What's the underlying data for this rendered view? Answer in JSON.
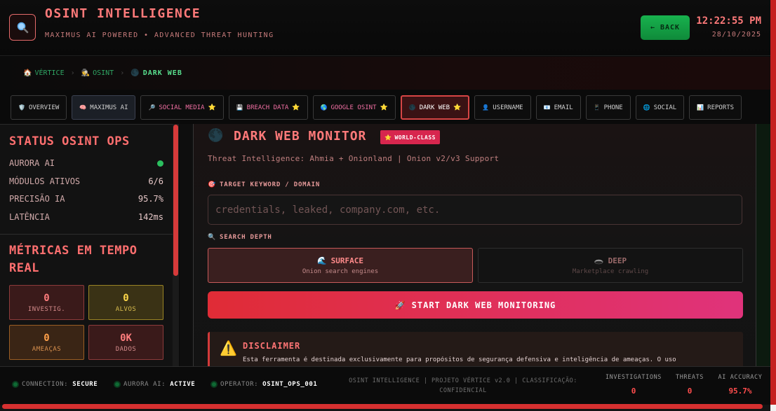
{
  "header": {
    "logo_icon": "magnifier-icon",
    "title": "OSINT INTELLIGENCE",
    "subtitle": "MAXIMUS AI POWERED • ADVANCED THREAT HUNTING",
    "back_label": "← BACK",
    "time": "12:22:55 PM",
    "date": "28/10/2025"
  },
  "breadcrumb": [
    {
      "icon": "🏠",
      "label": "VÉRTICE"
    },
    {
      "icon": "🕵️",
      "label": "OSINT"
    },
    {
      "icon": "🌑",
      "label": "DARK WEB"
    }
  ],
  "tabs": [
    {
      "icon": "🛡️",
      "label": "OVERVIEW",
      "star": ""
    },
    {
      "icon": "🧠",
      "label": "MAXIMUS AI",
      "star": ""
    },
    {
      "icon": "🔎",
      "label": "SOCIAL MEDIA",
      "star": "⭐"
    },
    {
      "icon": "💾",
      "label": "BREACH DATA",
      "star": "⭐"
    },
    {
      "icon": "🌎",
      "label": "GOOGLE OSINT",
      "star": "⭐"
    },
    {
      "icon": "🌑",
      "label": "DARK WEB",
      "star": "⭐"
    },
    {
      "icon": "👤",
      "label": "USERNAME",
      "star": ""
    },
    {
      "icon": "📧",
      "label": "EMAIL",
      "star": ""
    },
    {
      "icon": "📱",
      "label": "PHONE",
      "star": ""
    },
    {
      "icon": "🌐",
      "label": "SOCIAL",
      "star": ""
    },
    {
      "icon": "📊",
      "label": "REPORTS",
      "star": ""
    }
  ],
  "sidebar": {
    "status_title": "STATUS OSINT OPS",
    "status_rows": [
      {
        "label": "AURORA AI",
        "value": ""
      },
      {
        "label": "MÓDULOS ATIVOS",
        "value": "6/6"
      },
      {
        "label": "PRECISÃO IA",
        "value": "95.7%"
      },
      {
        "label": "LATÊNCIA",
        "value": "142ms"
      }
    ],
    "metrics_title": "MÉTRICAS EM TEMPO REAL",
    "metrics": [
      {
        "value": "0",
        "label": "INVESTIG."
      },
      {
        "value": "0",
        "label": "ALVOS"
      },
      {
        "value": "0",
        "label": "AMEAÇAS"
      },
      {
        "value": "0K",
        "label": "DADOS"
      }
    ]
  },
  "main": {
    "icon": "🌑",
    "title": "DARK WEB MONITOR",
    "badge": "WORLD-CLASS",
    "badge_icon": "⭐",
    "description": "Threat Intelligence: Ahmia + Onionland | Onion v2/v3 Support",
    "keyword_label": "TARGET KEYWORD / DOMAIN",
    "keyword_label_icon": "🎯",
    "keyword_placeholder": "credentials, leaked, company.com, etc.",
    "keyword_value": "",
    "depth_label": "SEARCH DEPTH",
    "depth_label_icon": "🔍",
    "depth_options": [
      {
        "icon": "🌊",
        "title": "SURFACE",
        "desc": "Onion search engines",
        "selected": true
      },
      {
        "icon": "🕳️",
        "title": "DEEP",
        "desc": "Marketplace crawling",
        "selected": false
      }
    ],
    "start_icon": "🚀",
    "start_label": "START DARK WEB MONITORING",
    "disclaimer_icon": "⚠️",
    "disclaimer_title": "DISCLAIMER",
    "disclaimer_text": "Esta ferramenta é destinada exclusivamente para propósitos de segurança defensiva e inteligência de ameaças. O uso"
  },
  "footer": {
    "statuses": [
      {
        "label": "CONNECTION:",
        "value": "SECURE"
      },
      {
        "label": "AURORA AI:",
        "value": "ACTIVE"
      },
      {
        "label": "OPERATOR:",
        "value": "OSINT_OPS_001"
      }
    ],
    "center_text": "OSINT INTELLIGENCE | PROJETO VÉRTICE v2.0 | CLASSIFICAÇÃO: CONFIDENCIAL",
    "metrics": [
      {
        "label": "INVESTIGATIONS",
        "value": "0"
      },
      {
        "label": "THREATS",
        "value": "0"
      },
      {
        "label": "AI ACCURACY",
        "value": "95.7%"
      }
    ]
  },
  "colors": {
    "accent_red": "#ff7a7a",
    "brand_green": "#18b24e",
    "status_green": "#2bbf5f",
    "badge_pink": "#d7264e"
  }
}
